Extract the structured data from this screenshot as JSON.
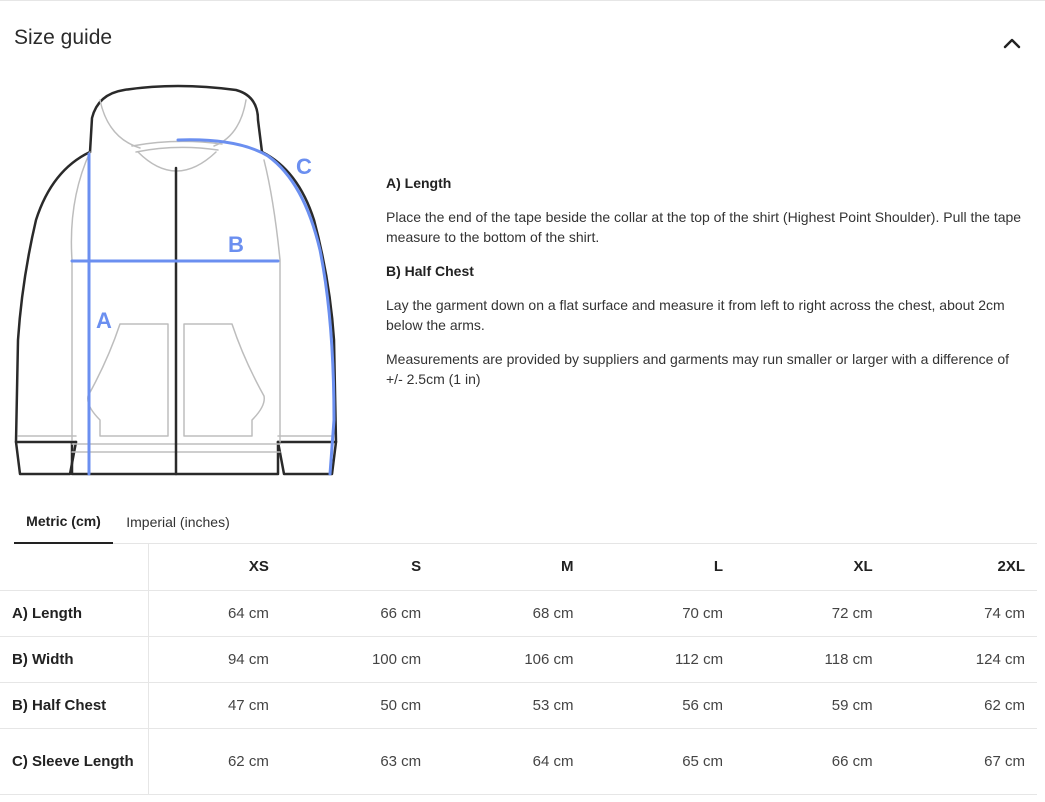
{
  "header": {
    "title": "Size guide"
  },
  "diagram": {
    "labels": {
      "a": "A",
      "b": "B",
      "c": "C"
    },
    "accent_color": "#6b8ff0",
    "outline_color": "#2a2a2a",
    "detail_color": "#bdbdbd"
  },
  "instructions": {
    "length_heading": "A) Length",
    "length_text": "Place the end of the tape beside the collar at the top of the shirt (Highest Point Shoulder). Pull the tape measure to the bottom of the shirt.",
    "chest_heading": "B) Half Chest",
    "chest_text": "Lay the garment down on a flat surface and measure it from left to right across the chest, about 2cm below the arms.",
    "note_text": "Measurements are provided by suppliers and garments may run smaller or larger with a difference of +/- 2.5cm (1 in)"
  },
  "tabs": [
    {
      "label": "Metric (cm)",
      "active": true
    },
    {
      "label": "Imperial (inches)",
      "active": false
    }
  ],
  "table": {
    "sizes": [
      "XS",
      "S",
      "M",
      "L",
      "XL",
      "2XL"
    ],
    "rows": [
      {
        "label": "A) Length",
        "values": [
          "64 cm",
          "66 cm",
          "68 cm",
          "70 cm",
          "72 cm",
          "74 cm"
        ]
      },
      {
        "label": "B) Width",
        "values": [
          "94 cm",
          "100 cm",
          "106 cm",
          "112 cm",
          "118 cm",
          "124 cm"
        ]
      },
      {
        "label": "B) Half Chest",
        "values": [
          "47 cm",
          "50 cm",
          "53 cm",
          "56 cm",
          "59 cm",
          "62 cm"
        ]
      },
      {
        "label": "C) Sleeve Length",
        "values": [
          "62 cm",
          "63 cm",
          "64 cm",
          "65 cm",
          "66 cm",
          "67 cm"
        ]
      }
    ]
  }
}
